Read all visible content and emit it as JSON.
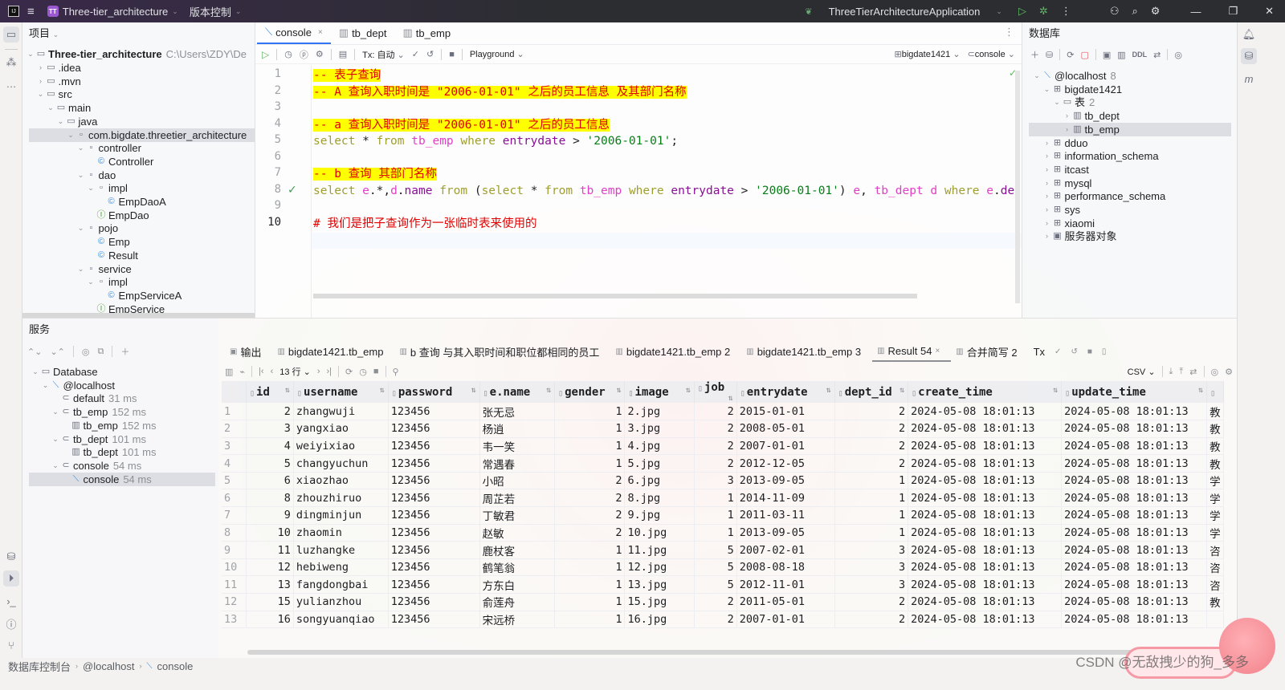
{
  "titlebar": {
    "project_name": "Three-tier_architecture",
    "project_badge": "TT",
    "vcs_label": "版本控制",
    "run_config": "ThreeTierArchitectureApplication"
  },
  "project_panel": {
    "title": "项目",
    "root": {
      "name": "Three-tier_architecture",
      "path": "C:\\Users\\ZDY\\De"
    },
    "items": [
      {
        "label": ".idea",
        "depth": 1,
        "type": "folder",
        "expanded": false
      },
      {
        "label": ".mvn",
        "depth": 1,
        "type": "folder",
        "expanded": false
      },
      {
        "label": "src",
        "depth": 1,
        "type": "folder",
        "expanded": true
      },
      {
        "label": "main",
        "depth": 2,
        "type": "folder",
        "expanded": true
      },
      {
        "label": "java",
        "depth": 3,
        "type": "folder",
        "expanded": true
      },
      {
        "label": "com.bigdate.threetier_architecture",
        "depth": 4,
        "type": "package",
        "expanded": true,
        "selected": true
      },
      {
        "label": "controller",
        "depth": 5,
        "type": "package",
        "expanded": true
      },
      {
        "label": "Controller",
        "depth": 6,
        "type": "class"
      },
      {
        "label": "dao",
        "depth": 5,
        "type": "package",
        "expanded": true
      },
      {
        "label": "impl",
        "depth": 6,
        "type": "package",
        "expanded": true
      },
      {
        "label": "EmpDaoA",
        "depth": 7,
        "type": "class"
      },
      {
        "label": "EmpDao",
        "depth": 6,
        "type": "interface"
      },
      {
        "label": "pojo",
        "depth": 5,
        "type": "package",
        "expanded": true
      },
      {
        "label": "Emp",
        "depth": 6,
        "type": "class"
      },
      {
        "label": "Result",
        "depth": 6,
        "type": "class"
      },
      {
        "label": "service",
        "depth": 5,
        "type": "package",
        "expanded": true
      },
      {
        "label": "impl",
        "depth": 6,
        "type": "package",
        "expanded": true
      },
      {
        "label": "EmpServiceA",
        "depth": 7,
        "type": "class"
      },
      {
        "label": "EmpService",
        "depth": 6,
        "type": "interface"
      }
    ]
  },
  "editor": {
    "tabs": [
      {
        "label": "console",
        "active": true,
        "closable": true
      },
      {
        "label": "tb_dept",
        "active": false
      },
      {
        "label": "tb_emp",
        "active": false
      }
    ],
    "toolbar": {
      "tx_label": "Tx: 自动",
      "playground_label": "Playground",
      "schema": "bigdate1421",
      "session": "console"
    },
    "current_line": 10,
    "lines": [
      {
        "n": 1,
        "segments": [
          {
            "t": "-- 表子查询",
            "c": "cmt"
          }
        ]
      },
      {
        "n": 2,
        "segments": [
          {
            "t": "-- A 查询入职时间是 \"2006-01-01\" 之后的员工信息 及其部门名称",
            "c": "cmt"
          }
        ]
      },
      {
        "n": 3,
        "segments": []
      },
      {
        "n": 4,
        "segments": [
          {
            "t": "-- a 查询入职时间是 \"2006-01-01\" 之后的员工信息",
            "c": "cmt"
          }
        ]
      },
      {
        "n": 5,
        "segments": [
          {
            "t": "select",
            "c": "kw"
          },
          {
            "t": " * ",
            "c": ""
          },
          {
            "t": "from",
            "c": "kw"
          },
          {
            "t": " ",
            "c": ""
          },
          {
            "t": "tb_emp",
            "c": "tbl"
          },
          {
            "t": " ",
            "c": ""
          },
          {
            "t": "where",
            "c": "kw"
          },
          {
            "t": " ",
            "c": ""
          },
          {
            "t": "entrydate",
            "c": "col"
          },
          {
            "t": " > ",
            "c": ""
          },
          {
            "t": "'2006-01-01'",
            "c": "str"
          },
          {
            "t": ";",
            "c": ""
          }
        ]
      },
      {
        "n": 6,
        "segments": []
      },
      {
        "n": 7,
        "segments": [
          {
            "t": "-- b 查询 其部门名称",
            "c": "cmt"
          }
        ]
      },
      {
        "n": 8,
        "check": true,
        "segments": [
          {
            "t": "select",
            "c": "kw"
          },
          {
            "t": " ",
            "c": ""
          },
          {
            "t": "e",
            "c": "tbl"
          },
          {
            "t": ".*,",
            "c": ""
          },
          {
            "t": "d",
            "c": "tbl"
          },
          {
            "t": ".",
            "c": ""
          },
          {
            "t": "name",
            "c": "col"
          },
          {
            "t": " ",
            "c": ""
          },
          {
            "t": "from",
            "c": "kw"
          },
          {
            "t": " (",
            "c": ""
          },
          {
            "t": "select",
            "c": "kw"
          },
          {
            "t": " * ",
            "c": ""
          },
          {
            "t": "from",
            "c": "kw"
          },
          {
            "t": " ",
            "c": ""
          },
          {
            "t": "tb_emp",
            "c": "tbl"
          },
          {
            "t": " ",
            "c": ""
          },
          {
            "t": "where",
            "c": "kw"
          },
          {
            "t": " ",
            "c": ""
          },
          {
            "t": "entrydate",
            "c": "col"
          },
          {
            "t": " > ",
            "c": ""
          },
          {
            "t": "'2006-01-01'",
            "c": "str"
          },
          {
            "t": ") ",
            "c": ""
          },
          {
            "t": "e",
            "c": "tbl"
          },
          {
            "t": ", ",
            "c": ""
          },
          {
            "t": "tb_dept",
            "c": "tbl"
          },
          {
            "t": " ",
            "c": ""
          },
          {
            "t": "d",
            "c": "tbl"
          },
          {
            "t": " ",
            "c": ""
          },
          {
            "t": "where",
            "c": "kw"
          },
          {
            "t": " ",
            "c": ""
          },
          {
            "t": "e",
            "c": "tbl"
          },
          {
            "t": ".",
            "c": ""
          },
          {
            "t": "de",
            "c": "col"
          }
        ]
      },
      {
        "n": 9,
        "segments": []
      },
      {
        "n": 10,
        "segments": [
          {
            "t": "# 我们是把子查询作为一张临时表来使用的",
            "c": "cmt2"
          }
        ]
      }
    ]
  },
  "database_panel": {
    "title": "数据库",
    "toolbar_ddl": "DDL",
    "items": [
      {
        "label": "@localhost",
        "badge": "8",
        "depth": 0,
        "type": "host",
        "expanded": true
      },
      {
        "label": "bigdate1421",
        "depth": 1,
        "type": "schema",
        "expanded": true
      },
      {
        "label": "表",
        "badge": "2",
        "depth": 2,
        "type": "folder",
        "expanded": true
      },
      {
        "label": "tb_dept",
        "depth": 3,
        "type": "table",
        "expanded": false
      },
      {
        "label": "tb_emp",
        "depth": 3,
        "type": "table",
        "expanded": false,
        "selected": true
      },
      {
        "label": "dduo",
        "depth": 1,
        "type": "schema",
        "expanded": false
      },
      {
        "label": "information_schema",
        "depth": 1,
        "type": "schema",
        "expanded": false
      },
      {
        "label": "itcast",
        "depth": 1,
        "type": "schema",
        "expanded": false
      },
      {
        "label": "mysql",
        "depth": 1,
        "type": "schema",
        "expanded": false
      },
      {
        "label": "performance_schema",
        "depth": 1,
        "type": "schema",
        "expanded": false
      },
      {
        "label": "sys",
        "depth": 1,
        "type": "schema",
        "expanded": false
      },
      {
        "label": "xiaomi",
        "depth": 1,
        "type": "schema",
        "expanded": false
      },
      {
        "label": "服务器对象",
        "depth": 1,
        "type": "server-objects",
        "expanded": false
      }
    ]
  },
  "services_panel": {
    "title": "服务",
    "items": [
      {
        "label": "Database",
        "depth": 0,
        "type": "folder",
        "expanded": true
      },
      {
        "label": "@localhost",
        "depth": 1,
        "type": "host",
        "expanded": true
      },
      {
        "label": "default",
        "time": "31 ms",
        "depth": 2,
        "type": "session"
      },
      {
        "label": "tb_emp",
        "time": "152 ms",
        "depth": 2,
        "type": "session",
        "expanded": true
      },
      {
        "label": "tb_emp",
        "time": "152 ms",
        "depth": 3,
        "type": "table"
      },
      {
        "label": "tb_dept",
        "time": "101 ms",
        "depth": 2,
        "type": "session",
        "expanded": true
      },
      {
        "label": "tb_dept",
        "time": "101 ms",
        "depth": 3,
        "type": "table"
      },
      {
        "label": "console",
        "time": "54 ms",
        "depth": 2,
        "type": "session",
        "expanded": true
      },
      {
        "label": "console",
        "time": "54 ms",
        "depth": 3,
        "type": "console",
        "selected": true
      }
    ]
  },
  "results": {
    "tabs": [
      {
        "label": "输出",
        "icon": "output"
      },
      {
        "label": "bigdate1421.tb_emp",
        "icon": "table"
      },
      {
        "label": "b 查询 与其入职时间和职位都相同的员工",
        "icon": "table"
      },
      {
        "label": "bigdate1421.tb_emp 2",
        "icon": "table"
      },
      {
        "label": "bigdate1421.tb_emp 3",
        "icon": "table"
      },
      {
        "label": "Result 54",
        "icon": "table",
        "active": true,
        "closable": true
      },
      {
        "label": "合并简写 2",
        "icon": "table"
      }
    ],
    "tx_label": "Tx",
    "rows_label": "13 行",
    "export_format": "CSV",
    "columns": [
      "id",
      "username",
      "password",
      "e.name",
      "gender",
      "image",
      "job",
      "entrydate",
      "dept_id",
      "create_time",
      "update_time",
      ""
    ],
    "rows": [
      [
        "1",
        "2",
        "zhangwuji",
        "123456",
        "张无忌",
        "1",
        "2.jpg",
        "2",
        "2015-01-01",
        "2",
        "2024-05-08 18:01:13",
        "2024-05-08 18:01:13",
        "教"
      ],
      [
        "2",
        "3",
        "yangxiao",
        "123456",
        "杨逍",
        "1",
        "3.jpg",
        "2",
        "2008-05-01",
        "2",
        "2024-05-08 18:01:13",
        "2024-05-08 18:01:13",
        "教"
      ],
      [
        "3",
        "4",
        "weiyixiao",
        "123456",
        "韦一笑",
        "1",
        "4.jpg",
        "2",
        "2007-01-01",
        "2",
        "2024-05-08 18:01:13",
        "2024-05-08 18:01:13",
        "教"
      ],
      [
        "4",
        "5",
        "changyuchun",
        "123456",
        "常遇春",
        "1",
        "5.jpg",
        "2",
        "2012-12-05",
        "2",
        "2024-05-08 18:01:13",
        "2024-05-08 18:01:13",
        "教"
      ],
      [
        "5",
        "6",
        "xiaozhao",
        "123456",
        "小昭",
        "2",
        "6.jpg",
        "3",
        "2013-09-05",
        "1",
        "2024-05-08 18:01:13",
        "2024-05-08 18:01:13",
        "学"
      ],
      [
        "6",
        "8",
        "zhouzhiruo",
        "123456",
        "周芷若",
        "2",
        "8.jpg",
        "1",
        "2014-11-09",
        "1",
        "2024-05-08 18:01:13",
        "2024-05-08 18:01:13",
        "学"
      ],
      [
        "7",
        "9",
        "dingminjun",
        "123456",
        "丁敏君",
        "2",
        "9.jpg",
        "1",
        "2011-03-11",
        "1",
        "2024-05-08 18:01:13",
        "2024-05-08 18:01:13",
        "学"
      ],
      [
        "8",
        "10",
        "zhaomin",
        "123456",
        "赵敏",
        "2",
        "10.jpg",
        "1",
        "2013-09-05",
        "1",
        "2024-05-08 18:01:13",
        "2024-05-08 18:01:13",
        "学"
      ],
      [
        "9",
        "11",
        "luzhangke",
        "123456",
        "鹿杖客",
        "1",
        "11.jpg",
        "5",
        "2007-02-01",
        "3",
        "2024-05-08 18:01:13",
        "2024-05-08 18:01:13",
        "咨"
      ],
      [
        "10",
        "12",
        "hebiweng",
        "123456",
        "鹤笔翁",
        "1",
        "12.jpg",
        "5",
        "2008-08-18",
        "3",
        "2024-05-08 18:01:13",
        "2024-05-08 18:01:13",
        "咨"
      ],
      [
        "11",
        "13",
        "fangdongbai",
        "123456",
        "方东白",
        "1",
        "13.jpg",
        "5",
        "2012-11-01",
        "3",
        "2024-05-08 18:01:13",
        "2024-05-08 18:01:13",
        "咨"
      ],
      [
        "12",
        "15",
        "yulianzhou",
        "123456",
        "俞莲舟",
        "1",
        "15.jpg",
        "2",
        "2011-05-01",
        "2",
        "2024-05-08 18:01:13",
        "2024-05-08 18:01:13",
        "教"
      ],
      [
        "13",
        "16",
        "songyuanqiao",
        "123456",
        "宋远桥",
        "1",
        "16.jpg",
        "2",
        "2007-01-01",
        "2",
        "2024-05-08 18:01:13",
        "2024-05-08 18:01:13",
        ""
      ]
    ]
  },
  "statusbar": {
    "crumbs": [
      "数据库控制台",
      "@localhost",
      "console"
    ]
  },
  "watermark": "CSDN @无敌拽少的狗_多多",
  "colors": {
    "accent": "#3574f0",
    "comment_bg": "#ffff00",
    "comment_fg": "#e00000",
    "keyword": "#9e9e2e",
    "table": "#e040c8",
    "column": "#871094",
    "string": "#067d17"
  }
}
